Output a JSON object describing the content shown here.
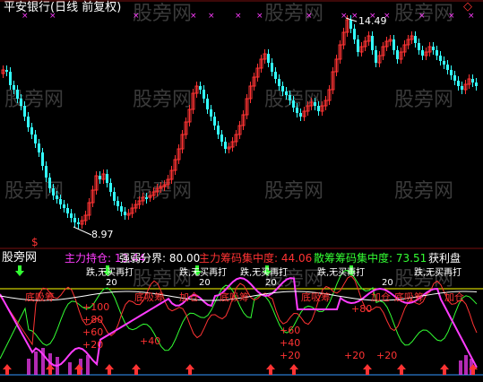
{
  "header": {
    "title": "平安银行(日线 前复权)",
    "corner_icon": "diamond-icon"
  },
  "watermark": "股旁网",
  "upper_panel": {
    "high_label": "14.49",
    "low_label": "8.97",
    "signal_label": "$"
  },
  "indicator": {
    "source": "股旁网",
    "items": [
      {
        "label": "主力持仓:",
        "value": "13.44",
        "color": "#ff3cff"
      },
      {
        "label": "强弱分界:",
        "value": "80.00",
        "color": "#ffffff"
      },
      {
        "label": "主力筹码集中度:",
        "value": "44.06",
        "color": "#ff3333"
      },
      {
        "label": "散筹筹码集中度:",
        "value": "73.51",
        "color": "#33ff33"
      },
      {
        "label": "获利盘",
        "value": "",
        "color": "#ffffff"
      }
    ]
  },
  "overlay_texts": {
    "green_tag": "跌,无买再打",
    "green_num": "20",
    "red_tag": "底吸筹",
    "red_tag_alt": "加仓",
    "num_60": "+60",
    "num_40": "+40",
    "num_20": "+20",
    "num_100": "+100",
    "num_80": "+80"
  },
  "colors": {
    "up": "#ff3333",
    "down": "#33ffff",
    "main_line": "#ff3cff",
    "retail_line": "#33ff33",
    "profit_line": "#ff3333",
    "strong_line": "#ffffff",
    "yellow_line": "#ffff00",
    "arrow_up": "#ff3333",
    "arrow_down": "#33ff33",
    "mark": "#ff3cff"
  }
}
